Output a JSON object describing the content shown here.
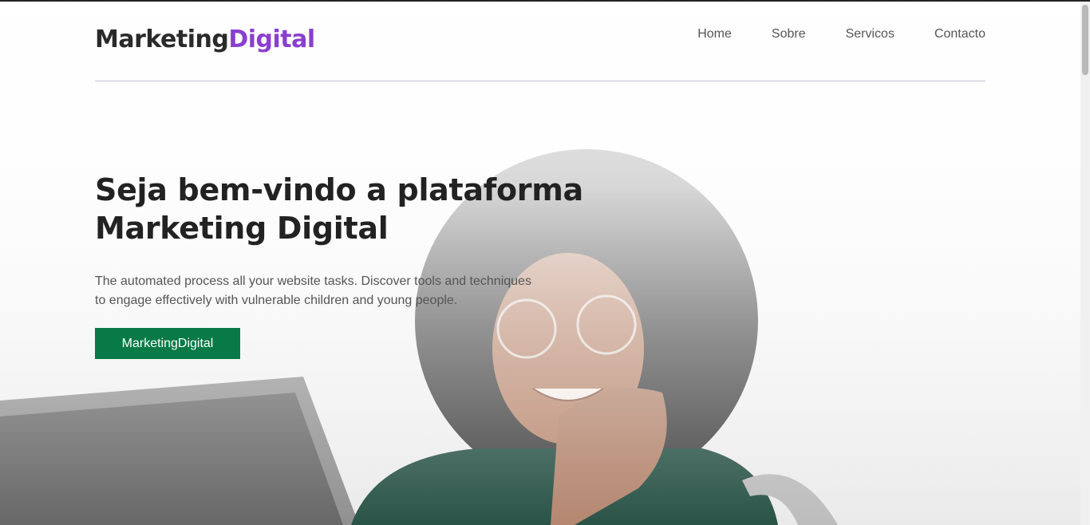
{
  "header": {
    "logo_part1": "Marketing",
    "logo_part2": "Digital",
    "nav": [
      {
        "label": "Home"
      },
      {
        "label": "Sobre"
      },
      {
        "label": "Servicos"
      },
      {
        "label": "Contacto"
      }
    ]
  },
  "hero": {
    "title_line1": "Seja bem-vindo a plataforma",
    "title_line2": "Marketing Digital",
    "desc_line1": "The automated process all your website tasks. Discover tools and techniques",
    "desc_line2": "to engage effectively with vulnerable children and young people.",
    "cta_label": "MarketingDigital"
  },
  "colors": {
    "logo_accent": "#8a3fcf",
    "cta_background": "#077a47",
    "text_dark": "#222222",
    "header_rule": "#c8c2dd"
  }
}
